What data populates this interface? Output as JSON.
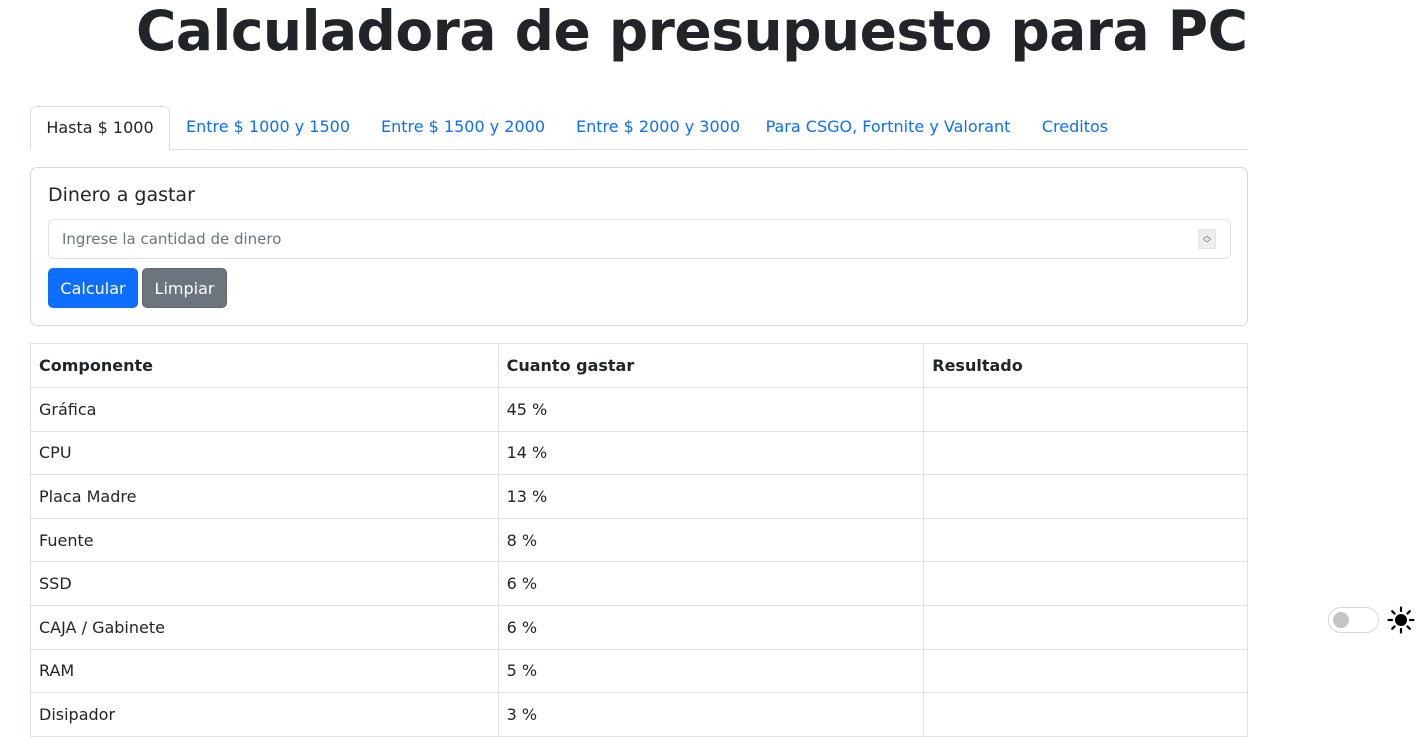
{
  "header": {
    "title": "Calculadora de presupuesto para PC"
  },
  "tabs": [
    {
      "label": "Hasta $ 1000"
    },
    {
      "label": "Entre $ 1000 y 1500"
    },
    {
      "label": "Entre $ 1500 y 2000"
    },
    {
      "label": "Entre $ 2000 y 3000"
    },
    {
      "label": "Para CSGO, Fortnite y Valorant"
    },
    {
      "label": "Creditos"
    }
  ],
  "form": {
    "label": "Dinero a gastar",
    "input_value": "",
    "input_placeholder": "Ingrese la cantidad de dinero",
    "calculate_label": "Calcular",
    "clear_label": "Limpiar"
  },
  "table": {
    "headers": [
      "Componente",
      "Cuanto gastar",
      "Resultado"
    ],
    "rows": [
      {
        "component": "Gráfica",
        "percent": "45 %",
        "result": ""
      },
      {
        "component": "CPU",
        "percent": "14 %",
        "result": ""
      },
      {
        "component": "Placa Madre",
        "percent": "13 %",
        "result": ""
      },
      {
        "component": "Fuente",
        "percent": "8 %",
        "result": ""
      },
      {
        "component": "SSD",
        "percent": "6 %",
        "result": ""
      },
      {
        "component": "CAJA / Gabinete",
        "percent": "6 %",
        "result": ""
      },
      {
        "component": "RAM",
        "percent": "5 %",
        "result": ""
      },
      {
        "component": "Disipador",
        "percent": "3 %",
        "result": ""
      }
    ]
  },
  "theme": {
    "dark_mode": false,
    "icon": "sun-icon"
  },
  "colors": {
    "primary": "#0d6efd",
    "secondary": "#6c757d",
    "text": "#212529",
    "border": "#dee2e6"
  }
}
